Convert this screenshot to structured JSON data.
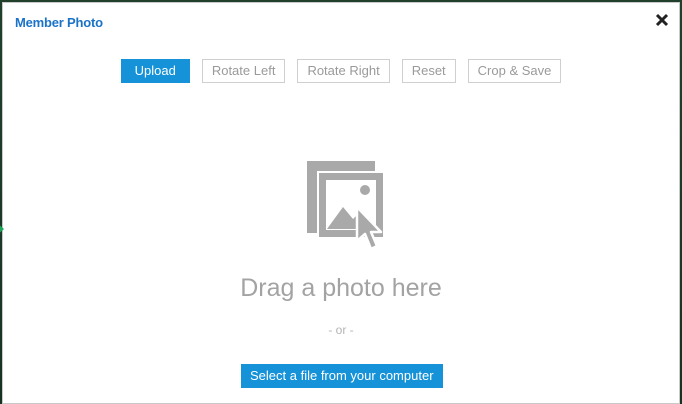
{
  "modal": {
    "title": "Member Photo",
    "close_icon": "close-icon"
  },
  "toolbar": {
    "buttons": [
      {
        "label": "Upload",
        "active": true
      },
      {
        "label": "Rotate Left",
        "active": false
      },
      {
        "label": "Rotate Right",
        "active": false
      },
      {
        "label": "Reset",
        "active": false
      },
      {
        "label": "Crop & Save",
        "active": false
      }
    ]
  },
  "drop_zone": {
    "icon": "photo-drop-icon",
    "drag_text": "Drag a photo here",
    "or_text": "- or -",
    "select_label": "Select a file from your computer"
  },
  "colors": {
    "accent": "#1592d8",
    "title": "#1a73c8",
    "muted": "#a3a3a3",
    "icon_gray": "#a9a9a9",
    "marker": "#1aa75a"
  }
}
